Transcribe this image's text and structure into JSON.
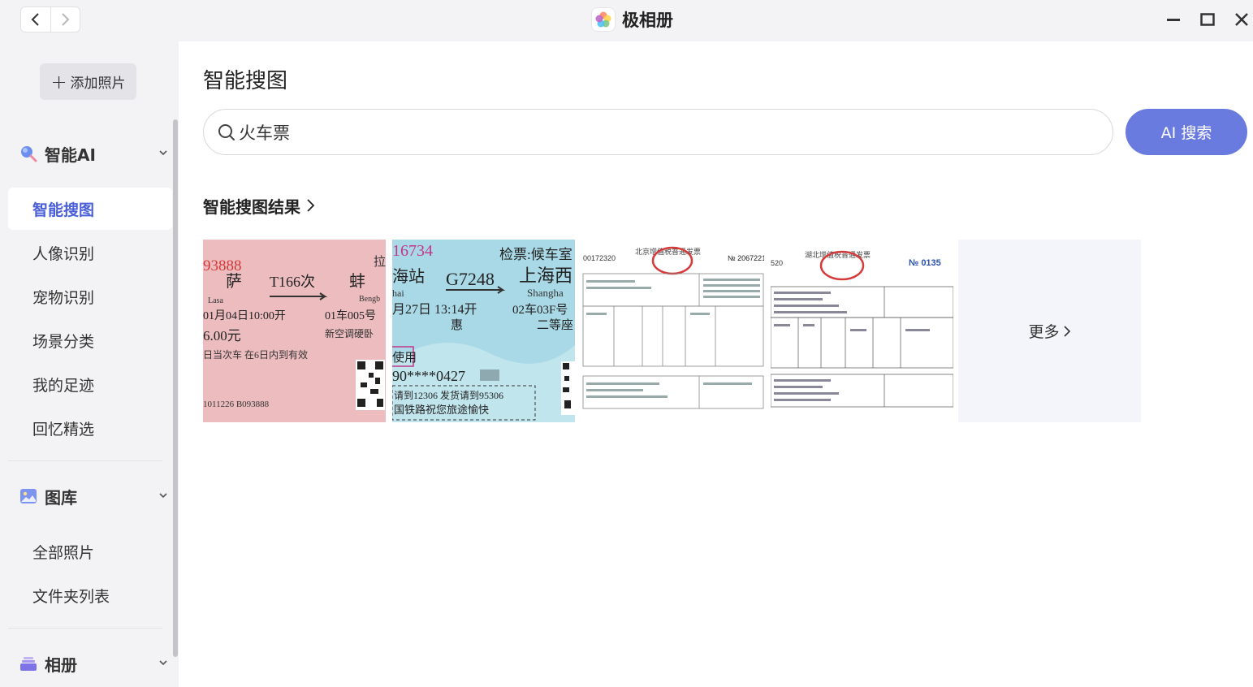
{
  "app": {
    "title": "极相册"
  },
  "sidebar": {
    "add_button": "添加照片",
    "sections": [
      {
        "label": "智能AI",
        "items": [
          "智能搜图",
          "人像识别",
          "宠物识别",
          "场景分类",
          "我的足迹",
          "回忆精选"
        ],
        "active_item": "智能搜图"
      },
      {
        "label": "图库",
        "items": [
          "全部照片",
          "文件夹列表"
        ]
      },
      {
        "label": "相册",
        "items": []
      }
    ]
  },
  "main": {
    "title": "智能搜图",
    "search": {
      "value": "火车票",
      "button": "AI 搜索"
    },
    "results": {
      "heading": "智能搜图结果",
      "more_label": "更多",
      "thumbs": [
        {
          "number": "93888",
          "station": "萨",
          "train": "T166次",
          "dest": "蚌",
          "dest_pinyin": "Bengb",
          "from_pinyin": "Lasa",
          "datetime": "01月04日10:00开",
          "seat": "01车005号",
          "price": "6.00元",
          "class": "新空调硬卧",
          "note": "日当次车 在6日内到有效",
          "serial": "1011226 B093888",
          "corner": "拉"
        },
        {
          "number": "16734",
          "gate": "检票:候车室",
          "station": "海站",
          "train": "G7248",
          "dest": "上海西",
          "station_pinyin": "hai",
          "dest_pinyin": "Shangha",
          "datetime": "月27日 13:14开",
          "seat": "02车03F号",
          "class": "二等座",
          "discount": "惠",
          "use": "使用",
          "id": "90****0427",
          "refund": "请到12306 发货请到95306",
          "slogan": "国铁路祝您旅途愉快"
        },
        {
          "number": "00172320",
          "title": "北京增值税普通发票",
          "no": "№ 2067221"
        },
        {
          "number": "520",
          "title": "湖北增值税普通发票",
          "no": "№ 0135"
        }
      ]
    }
  },
  "colors": {
    "accent": "#4a5fd8",
    "ai_button": "#6a7be0",
    "ticket_red": "#e9b3b6",
    "ticket_blue": "#a9d9e6"
  }
}
